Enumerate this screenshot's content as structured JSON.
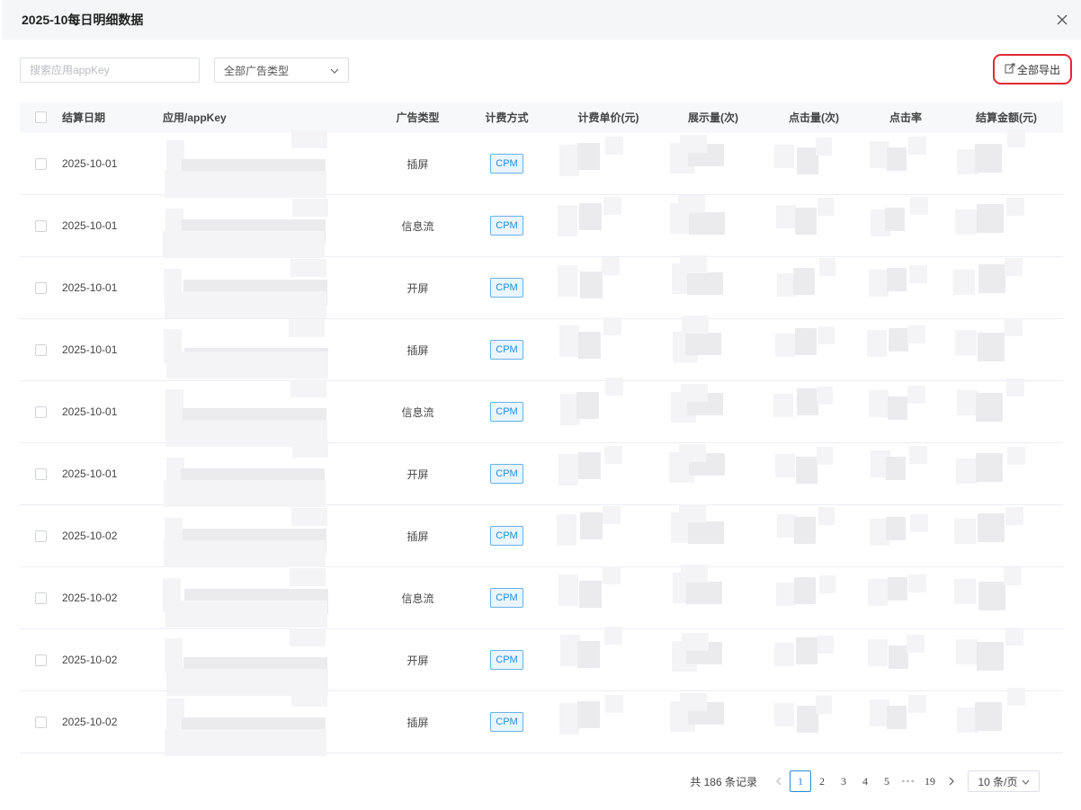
{
  "modal": {
    "title": "2025-10每日明细数据"
  },
  "toolbar": {
    "search_placeholder": "搜索应用appKey",
    "ad_type_select": "全部广告类型",
    "export_label": "全部导出"
  },
  "table": {
    "headers": {
      "date": "结算日期",
      "app": "应用/appKey",
      "ad_type": "广告类型",
      "billing": "计费方式",
      "unit_price": "计费单价(元)",
      "impressions": "展示量(次)",
      "clicks": "点击量(次)",
      "ctr": "点击率",
      "amount": "结算金额(元)"
    },
    "rows": [
      {
        "date": "2025-10-01",
        "ad_type": "插屏",
        "billing": "CPM"
      },
      {
        "date": "2025-10-01",
        "ad_type": "信息流",
        "billing": "CPM"
      },
      {
        "date": "2025-10-01",
        "ad_type": "开屏",
        "billing": "CPM"
      },
      {
        "date": "2025-10-01",
        "ad_type": "插屏",
        "billing": "CPM"
      },
      {
        "date": "2025-10-01",
        "ad_type": "信息流",
        "billing": "CPM"
      },
      {
        "date": "2025-10-01",
        "ad_type": "开屏",
        "billing": "CPM"
      },
      {
        "date": "2025-10-02",
        "ad_type": "插屏",
        "billing": "CPM"
      },
      {
        "date": "2025-10-02",
        "ad_type": "信息流",
        "billing": "CPM"
      },
      {
        "date": "2025-10-02",
        "ad_type": "开屏",
        "billing": "CPM"
      },
      {
        "date": "2025-10-02",
        "ad_type": "插屏",
        "billing": "CPM"
      }
    ]
  },
  "pagination": {
    "total_text": "共 186 条记录",
    "pages": [
      "1",
      "2",
      "3",
      "4",
      "5"
    ],
    "ellipsis": "•••",
    "last_page": "19",
    "page_size": "10 条/页",
    "current_page": "1"
  },
  "colors": {
    "accent": "#2b8ad6",
    "highlight": "#e0282e"
  },
  "icons": {
    "close": "close-icon",
    "export": "export-icon",
    "dropdown": "chevron-down-icon",
    "prev": "chevron-left-icon",
    "next": "chevron-right-icon"
  }
}
